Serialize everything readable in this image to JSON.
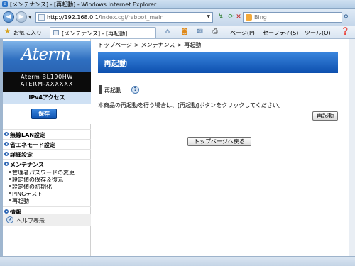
{
  "window": {
    "title": "[メンテナンス] - [再起動] - Windows Internet Explorer"
  },
  "addressbar": {
    "url_host": "http://192.168.0.1/",
    "url_path": "index.cgi/reboot_main",
    "search_placeholder": "Bing"
  },
  "favorites": {
    "label": "お気に入り",
    "tab_label": "[メンテナンス] - [再起動]",
    "commands": [
      "ページ(P)",
      "セーフティ(S)",
      "ツール(O)"
    ]
  },
  "sidebar": {
    "logo": "Aterm",
    "model_line1": "Aterm BL190HW",
    "model_line2": "ATERM-XXXXXX",
    "ipv4": "IPv4アクセス",
    "save_label": "保存",
    "menu": [
      {
        "label": "無線LAN設定"
      },
      {
        "label": "省エネモード設定"
      },
      {
        "label": "詳細設定"
      },
      {
        "label": "メンテナンス"
      }
    ],
    "submenu": [
      {
        "label": "管理者パスワードの変更"
      },
      {
        "label": "設定値の保存＆復元"
      },
      {
        "label": "設定値の初期化"
      },
      {
        "label": "PINGテスト"
      },
      {
        "label": "再起動"
      }
    ],
    "info": "情報",
    "help": "ヘルプ表示"
  },
  "main": {
    "breadcrumb": [
      "トップページ",
      "メンテナンス",
      "再起動"
    ],
    "title": "再起動",
    "section": "再起動",
    "description": "本商品の再起動を行う場合は、[再起動]ボタンをクリックしてください。",
    "reboot_button": "再起動",
    "top_button": "トップページへ戻る"
  }
}
